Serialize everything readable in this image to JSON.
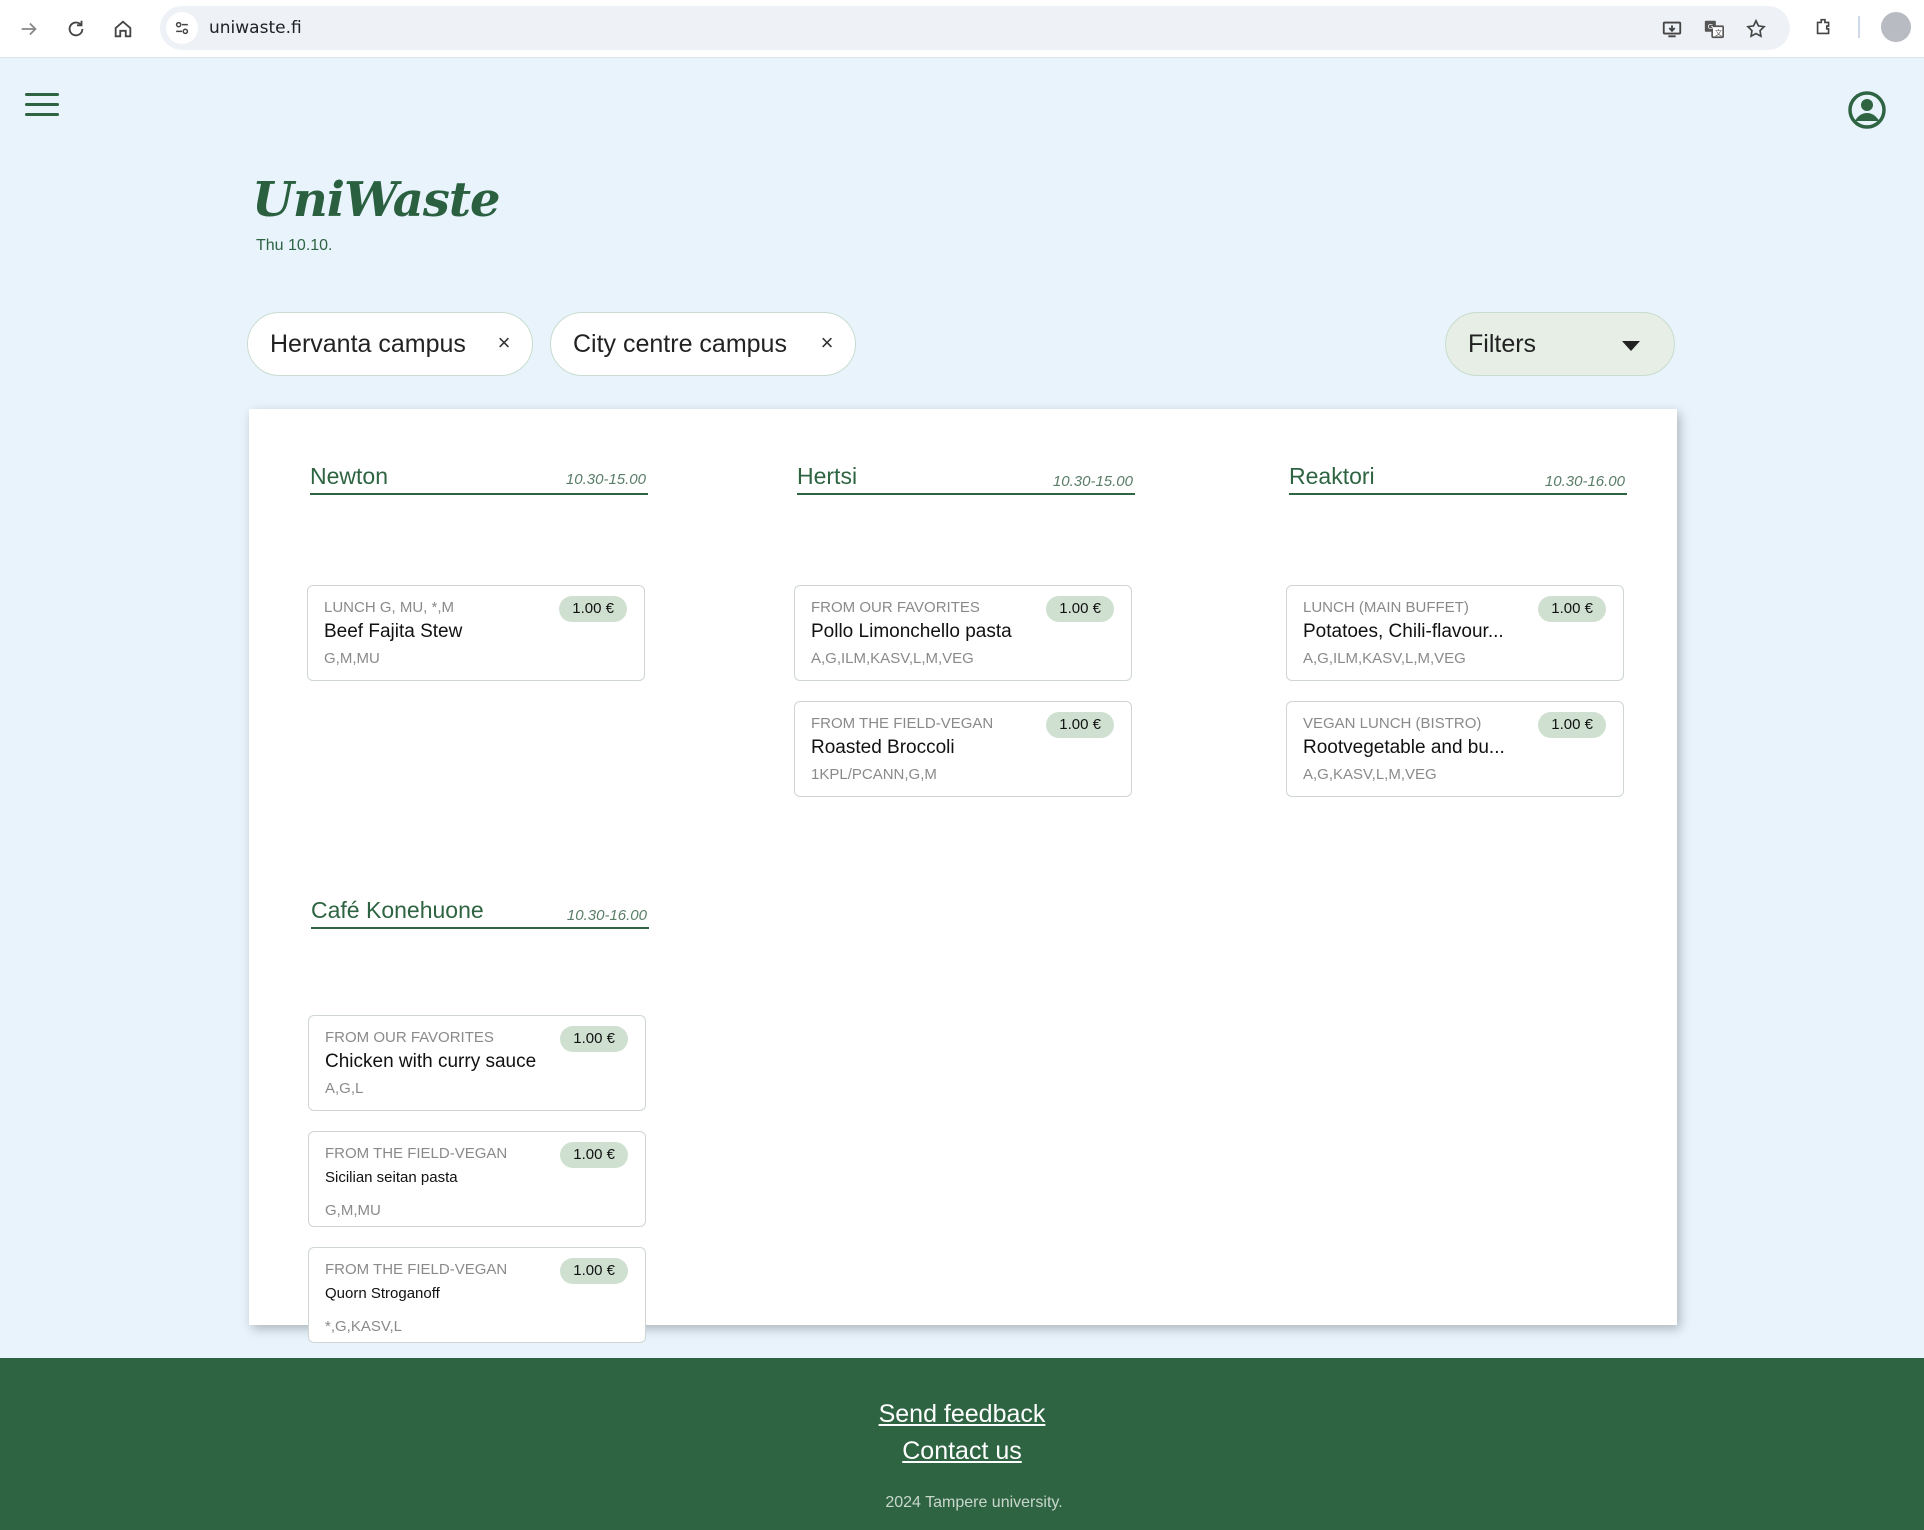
{
  "browser": {
    "url": "uniwaste.fi"
  },
  "header": {
    "logo": "UniWaste",
    "date": "Thu 10.10."
  },
  "chips": [
    {
      "label": "Hervanta campus"
    },
    {
      "label": "City centre campus"
    }
  ],
  "filters": {
    "label": "Filters"
  },
  "restaurants": [
    {
      "name": "Newton",
      "hours": "10.30-15.00",
      "items": [
        {
          "category": "LUNCH G, MU, *,M",
          "dish": "Beef Fajita Stew",
          "diet": "G,M,MU",
          "price": "1.00 €"
        }
      ]
    },
    {
      "name": "Hertsi",
      "hours": "10.30-15.00",
      "items": [
        {
          "category": "FROM OUR FAVORITES",
          "dish": "Pollo Limonchello pasta",
          "diet": "A,G,ILM,KASV,L,M,VEG",
          "price": "1.00 €"
        },
        {
          "category": "FROM THE FIELD-VEGAN",
          "dish": "Roasted Broccoli",
          "diet": "1KPL/PCANN,G,M",
          "price": "1.00 €"
        }
      ]
    },
    {
      "name": "Reaktori",
      "hours": "10.30-16.00",
      "items": [
        {
          "category": "LUNCH (MAIN BUFFET)",
          "dish": "Potatoes, Chili-flavour...",
          "diet": "A,G,ILM,KASV,L,M,VEG",
          "price": "1.00 €"
        },
        {
          "category": "VEGAN LUNCH (BISTRO)",
          "dish": "Rootvegetable and bu...",
          "diet": "A,G,KASV,L,M,VEG",
          "price": "1.00 €"
        }
      ]
    },
    {
      "name": "Café Konehuone",
      "hours": "10.30-16.00",
      "items": [
        {
          "category": "FROM OUR FAVORITES",
          "dish": "Chicken with curry sauce",
          "diet": "A,G,L",
          "price": "1.00 €"
        },
        {
          "category": "FROM THE FIELD-VEGAN",
          "dish": "Sicilian seitan pasta",
          "diet": "G,M,MU",
          "price": "1.00 €"
        },
        {
          "category": "FROM THE FIELD-VEGAN",
          "dish": "Quorn Stroganoff",
          "diet": "*,G,KASV,L",
          "price": "1.00 €"
        }
      ]
    }
  ],
  "footer": {
    "feedback": "Send feedback",
    "contact": "Contact us",
    "copyright": "2024 Tampere university."
  },
  "colors": {
    "brand_green": "#2e6442",
    "page_bg": "#e8f3fc",
    "price_badge": "#cfe0d0"
  }
}
